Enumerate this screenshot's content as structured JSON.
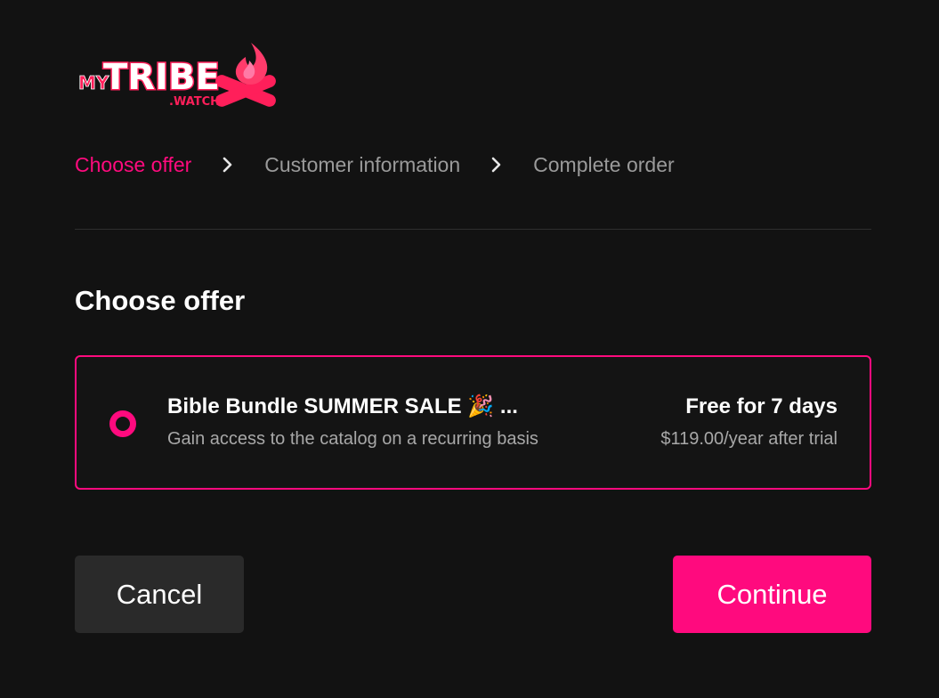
{
  "theme": {
    "accent": "#ff0a7e",
    "muted": "#9a9a9a",
    "background": "#121212"
  },
  "brand": {
    "logo_my": "MY",
    "logo_tribe": "TRIBE",
    "logo_suffix": ".WATCH"
  },
  "stepper": {
    "steps": [
      {
        "label": "Choose offer",
        "state": "active"
      },
      {
        "label": "Customer information",
        "state": "inactive"
      },
      {
        "label": "Complete order",
        "state": "inactive"
      }
    ],
    "separator_icon": "chevron-right-icon"
  },
  "main": {
    "title": "Choose offer",
    "offer": {
      "selected": true,
      "name": "Bible Bundle SUMMER SALE 🎉 ...",
      "description": "Gain access to the catalog on a recurring basis",
      "price_headline": "Free for 7 days",
      "price_detail": "$119.00/year after trial"
    }
  },
  "actions": {
    "cancel_label": "Cancel",
    "continue_label": "Continue"
  }
}
